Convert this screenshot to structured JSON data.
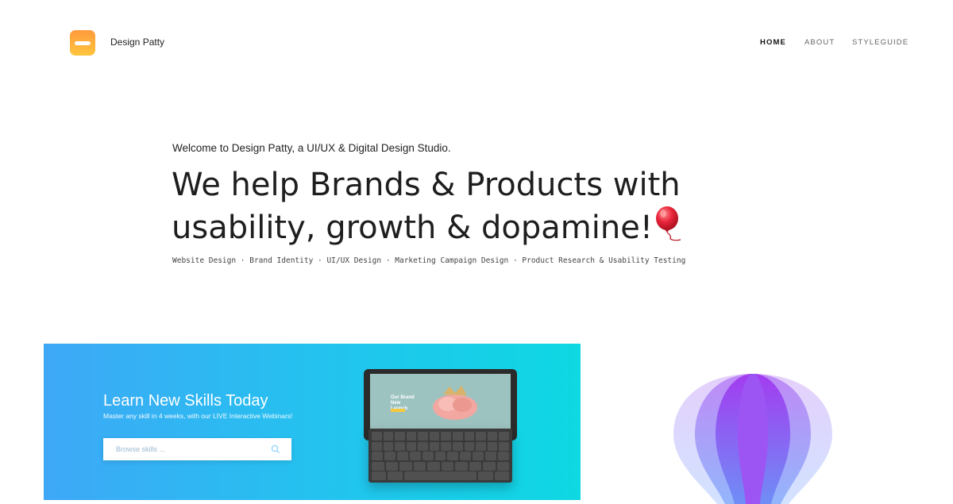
{
  "header": {
    "brand_name": "Design Patty",
    "nav": [
      {
        "label": "HOME",
        "active": true
      },
      {
        "label": "ABOUT",
        "active": false
      },
      {
        "label": "STYLEGUIDE",
        "active": false
      }
    ]
  },
  "hero": {
    "welcome": "Welcome to Design Patty, a UI/UX & Digital Design Studio.",
    "headline_line1": "We help Brands & Products with",
    "headline_line2": "usability, growth & dopamine!",
    "headline_icon": "balloon-icon",
    "services": "Website Design · Brand Identity · UI/UX Design · Marketing Campaign Design · Product Research & Usability Testing"
  },
  "banner": {
    "title": "Learn New Skills Today",
    "subtitle": "Master any skill in 4 weeks, with our LIVE Interactive Webinars!",
    "search_placeholder": "Browse skills ...",
    "search_icon": "search-icon",
    "device_screen_title": "Our Brand New Launch",
    "gradient_colors": [
      "#3ea8f7",
      "#0ed8e2"
    ]
  },
  "illustration": {
    "icon": "hot-air-balloon-icon",
    "colors": [
      "#a33cf0",
      "#7a8af5",
      "#c9d8ff"
    ]
  },
  "colors": {
    "logo_gradient": [
      "#ff9a3c",
      "#ffc53d"
    ],
    "text": "#1e1e1e"
  }
}
